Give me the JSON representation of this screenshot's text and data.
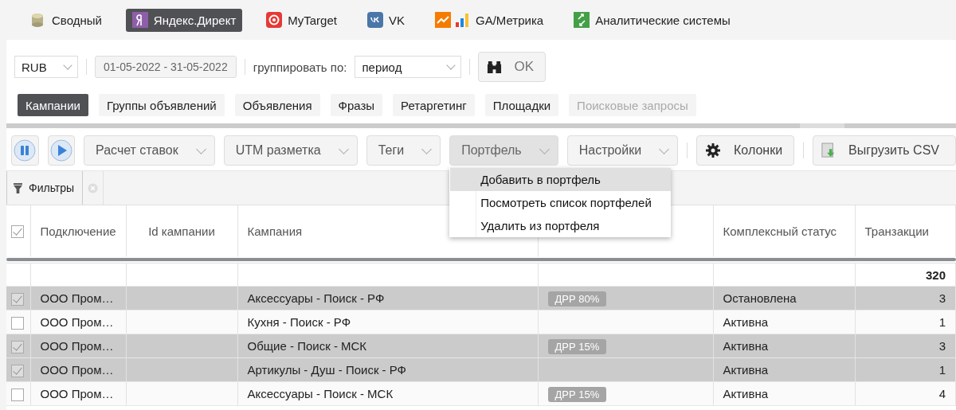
{
  "nav": [
    {
      "label": "Сводный",
      "selected": false
    },
    {
      "label": "Яндекс.Директ",
      "selected": true
    },
    {
      "label": "MyTarget",
      "selected": false
    },
    {
      "label": "VK",
      "selected": false
    },
    {
      "label": "GA/Метрика",
      "selected": false
    },
    {
      "label": "Аналитические системы",
      "selected": false
    }
  ],
  "filters": {
    "currency": "RUB",
    "date_range": "01-05-2022 - 31-05-2022",
    "group_label": "группировать по:",
    "group_value": "период",
    "ok": "OK"
  },
  "views": [
    {
      "label": "Кампании",
      "selected": true,
      "disabled": false
    },
    {
      "label": "Группы объявлений",
      "selected": false,
      "disabled": false
    },
    {
      "label": "Объявления",
      "selected": false,
      "disabled": false
    },
    {
      "label": "Фразы",
      "selected": false,
      "disabled": false
    },
    {
      "label": "Ретаргетинг",
      "selected": false,
      "disabled": false
    },
    {
      "label": "Площадки",
      "selected": false,
      "disabled": false
    },
    {
      "label": "Поисковые запросы",
      "selected": false,
      "disabled": true
    }
  ],
  "toolbar": {
    "dropdowns": [
      {
        "label": "Расчет ставок",
        "open": false
      },
      {
        "label": "UTM разметка",
        "open": false
      },
      {
        "label": "Теги",
        "open": false
      },
      {
        "label": "Портфель",
        "open": true
      },
      {
        "label": "Настройки",
        "open": false
      }
    ],
    "columns_button": "Колонки",
    "export_button": "Выгрузить CSV"
  },
  "menu": [
    {
      "label": "Добавить в портфель",
      "selected": true
    },
    {
      "label": "Посмотреть список портфелей",
      "selected": false
    },
    {
      "label": "Удалить из портфеля",
      "selected": false
    }
  ],
  "filters_button": "Фильтры",
  "table": {
    "header_checked": true,
    "columns": [
      {
        "kind": "text",
        "label": "Подключение"
      },
      {
        "kind": "text",
        "label": "Id кампании"
      },
      {
        "kind": "text",
        "label": "Кампания"
      },
      {
        "kind": "covered"
      },
      {
        "kind": "text",
        "label": "Комплексный статус"
      },
      {
        "kind": "text",
        "label": "Транзакции"
      }
    ],
    "totals": {
      "transactions": "320"
    },
    "rows": [
      {
        "checked": true,
        "connection": "ООО Пром…",
        "campaign": "Аксессуары - Поиск - РФ",
        "tag": "ДРР 80%",
        "status": "Остановлена",
        "transactions": "3"
      },
      {
        "checked": false,
        "connection": "ООО Пром…",
        "campaign": "Кухня - Поиск - РФ",
        "status": "Активна",
        "transactions": "1"
      },
      {
        "checked": true,
        "connection": "ООО Пром…",
        "campaign": "Общие - Поиск - МСК",
        "tag": "ДРР 15%",
        "status": "Активна",
        "transactions": "3"
      },
      {
        "checked": true,
        "connection": "ООО Пром…",
        "campaign": "Артикулы - Душ - Поиск - РФ",
        "status": "Активна",
        "transactions": "1"
      },
      {
        "checked": false,
        "connection": "ООО Пром…",
        "campaign": "Аксессуары - Поиск - МСК",
        "tag": "ДРР 15%",
        "status": "Активна",
        "transactions": "4"
      }
    ]
  }
}
